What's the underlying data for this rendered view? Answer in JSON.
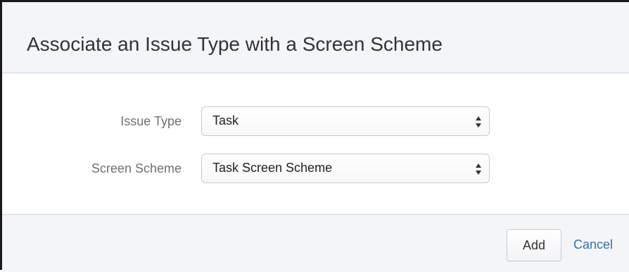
{
  "dialog": {
    "title": "Associate an Issue Type with a Screen Scheme"
  },
  "form": {
    "issue_type": {
      "label": "Issue Type",
      "selected": "Task"
    },
    "screen_scheme": {
      "label": "Screen Scheme",
      "selected": "Task Screen Scheme"
    }
  },
  "footer": {
    "add_label": "Add",
    "cancel_label": "Cancel"
  },
  "icons": {
    "select_arrows": "up-down-arrows-icon"
  },
  "colors": {
    "header_bg": "#f4f5f7",
    "link": "#3572b0",
    "label_text": "#707070",
    "border": "#c6ccd4"
  }
}
